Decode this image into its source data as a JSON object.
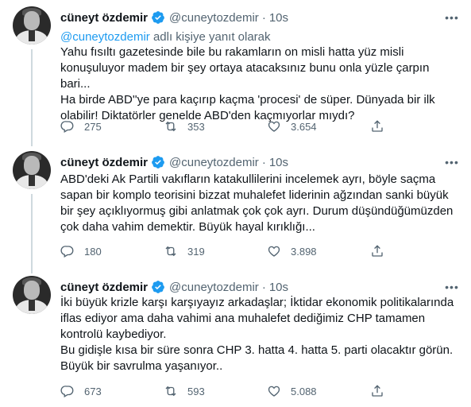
{
  "tweets": [
    {
      "name": "cüneyt özdemir",
      "handle": "@cuneytozdemir",
      "time": "10s",
      "replying_mention": "@cuneytozdemir",
      "replying_suffix": " adlı kişiye yanıt olarak",
      "text": "Yahu fısıltı gazetesinde bile bu rakamların on misli hatta yüz misli\nkonuşuluyor madem bir şey ortaya atacaksınız bunu onla yüzle çarpın bari...\nHa birde ABD''ye para kaçırıp kaçma 'procesi' de süper. Dünyada bir ilk\nolabilir! Diktatörler genelde ABD'den kaçmıyorlar mıydı?",
      "replies": "275",
      "retweets": "353",
      "likes": "3.654"
    },
    {
      "name": "cüneyt özdemir",
      "handle": "@cuneytozdemir",
      "time": "10s",
      "text": "ABD'deki Ak Partili vakıfların katakullilerini incelemek ayrı, böyle saçma\nsapan bir komplo teorisini bizzat muhalefet liderinin ağzından sanki büyük\nbir şey açıklıyormuş gibi anlatmak çok çok ayrı. Durum düşündüğümüzden\nçok daha vahim demektir. Büyük hayal kırıklığı...",
      "replies": "180",
      "retweets": "319",
      "likes": "3.898"
    },
    {
      "name": "cüneyt özdemir",
      "handle": "@cuneytozdemir",
      "time": "10s",
      "text": "İki büyük krizle karşı karşıyayız arkadaşlar; İktidar ekonomik politikalarında\niflas ediyor ama daha vahimi ana muhalefet dediğimiz CHP tamamen\nkontrolü kaybediyor.\nBu gidişle kısa bir süre sonra CHP 3. hatta 4. hatta 5. parti olacaktır görün.\nBüyük bir savrulma yaşanıyor..",
      "replies": "673",
      "retweets": "593",
      "likes": "5.088"
    }
  ],
  "icons": {
    "verified": "verified-badge-icon",
    "more": "more-icon",
    "reply": "reply-icon",
    "retweet": "retweet-icon",
    "like": "like-icon",
    "share": "share-icon"
  },
  "colors": {
    "accent": "#1d9bf0",
    "secondary_text": "#536471",
    "divider": "#eff3f4"
  }
}
